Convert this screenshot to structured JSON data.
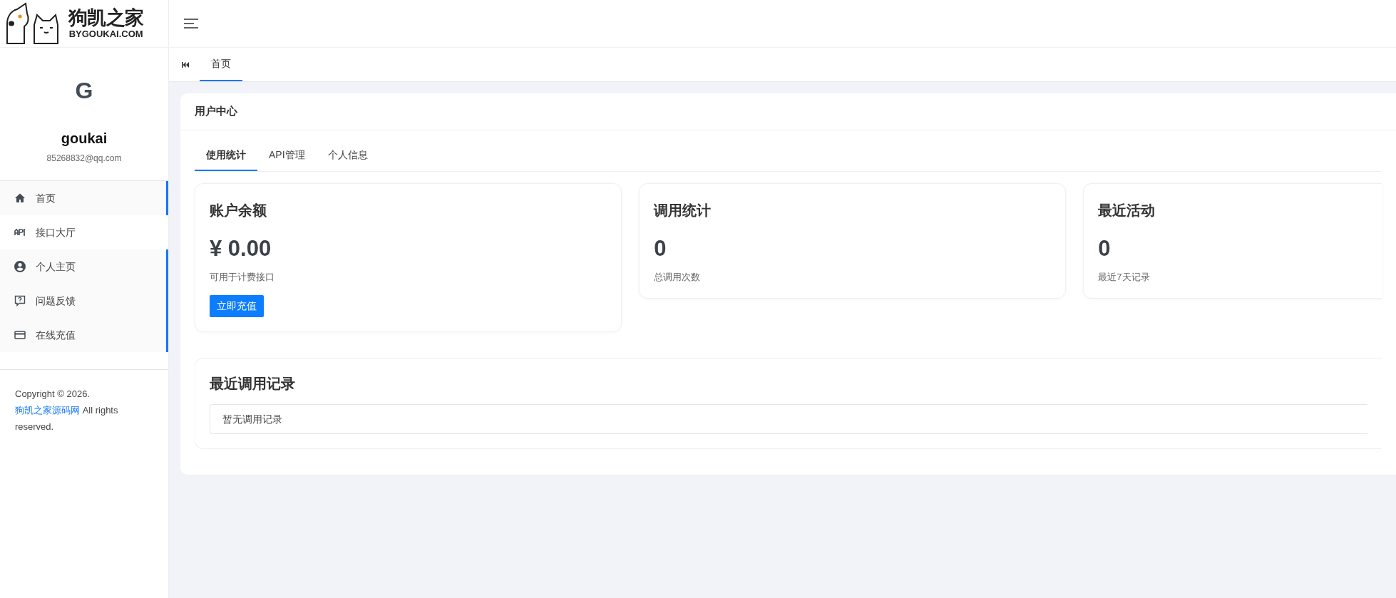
{
  "logo": {
    "title": "狗凯之家",
    "subtitle": "BYGOUKAI.COM"
  },
  "profile": {
    "initial": "G",
    "name": "goukai",
    "email": "85268832@qq.com"
  },
  "sidebar": {
    "items": [
      {
        "label": "首页",
        "kind": "home",
        "selected": true
      },
      {
        "label": "接口大厅",
        "kind": "api",
        "selected": false
      },
      {
        "label": "个人主页",
        "kind": "user",
        "selected": true
      },
      {
        "label": "问题反馈",
        "kind": "feedback",
        "selected": true
      },
      {
        "label": "在线充值",
        "kind": "card",
        "selected": true
      }
    ]
  },
  "footer": {
    "text": "Copyright © 2026.",
    "link": "狗凯之家源码网",
    "suffix": "All rights reserved."
  },
  "page_tabs": [
    {
      "label": "首页",
      "selected": true
    }
  ],
  "panel": {
    "title": "用户中心",
    "tabs": [
      {
        "label": "使用统计",
        "selected": true
      },
      {
        "label": "API管理",
        "selected": false
      },
      {
        "label": "个人信息",
        "selected": false
      }
    ],
    "cards": [
      {
        "title": "账户余额",
        "value": "¥ 0.00",
        "caption": "可用于计费接口",
        "button": "立即充值"
      },
      {
        "title": "调用统计",
        "value": "0",
        "caption": "总调用次数"
      },
      {
        "title": "最近活动",
        "value": "0",
        "caption": "最近7天记录"
      }
    ],
    "records": {
      "title": "最近调用记录",
      "empty": "暂无调用记录"
    }
  }
}
